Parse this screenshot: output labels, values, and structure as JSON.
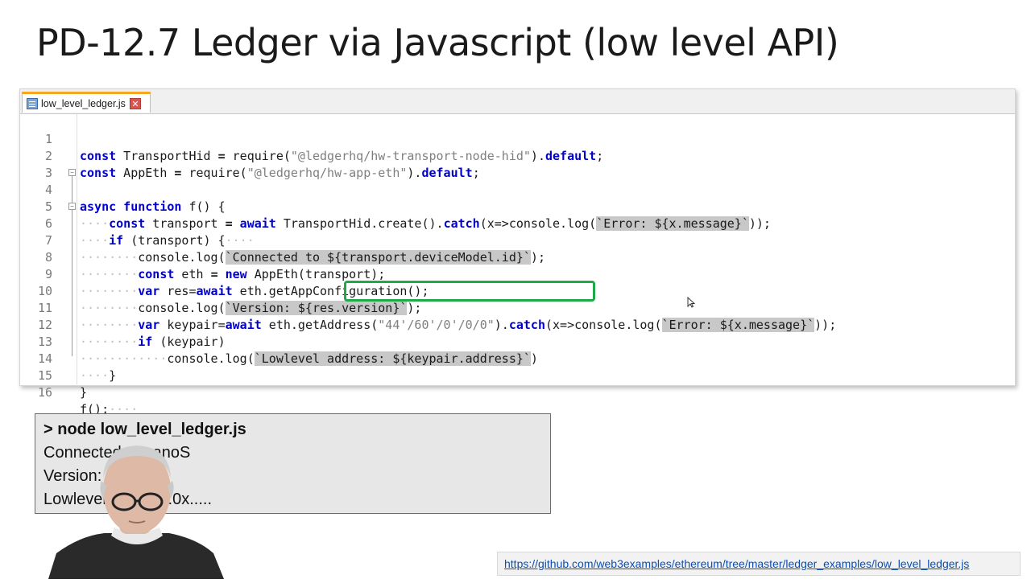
{
  "slide": {
    "title": "PD-12.7 Ledger via Javascript (low level API)"
  },
  "editor": {
    "tab_label": "low_level_ledger.js",
    "close_glyph": "✕",
    "fold_minus": "−",
    "line_numbers": [
      "1",
      "2",
      "3",
      "4",
      "5",
      "6",
      "7",
      "8",
      "9",
      "10",
      "11",
      "12",
      "13",
      "14",
      "15",
      "16"
    ],
    "highlight_color": "#1faa4a",
    "tab_accent_color": "#f5a623"
  },
  "code": {
    "l1": {
      "kw": "const",
      "a": " TransportHid ",
      "op": "=",
      "b": " require(",
      "str": "\"@ledgerhq/hw-transport-node-hid\"",
      "c": ").",
      "kw2": "default",
      "d": ";"
    },
    "l2": {
      "kw": "const",
      "a": " AppEth ",
      "op": "=",
      "b": " require(",
      "str": "\"@ledgerhq/hw-app-eth\"",
      "c": ").",
      "kw2": "default",
      "d": ";"
    },
    "l4": {
      "kw": "async function",
      "a": " f() {"
    },
    "l5": {
      "dots": "····",
      "kw": "const",
      "a": " transport ",
      "op": "=",
      "kw2": " await",
      "b": " TransportHid.create().",
      "kw3": "catch",
      "c": "(x=>console.log(",
      "tpl": "`Error: ${x.message}`",
      "d": "));"
    },
    "l6": {
      "dots": "····",
      "kw": "if",
      "a": " (transport) {",
      "dots2": "····"
    },
    "l7": {
      "dots": "········",
      "a": "console.log(",
      "tpl": "`Connected to ${transport.deviceModel.id}`",
      "b": ");"
    },
    "l8": {
      "dots": "········",
      "kw": "const",
      "a": " eth ",
      "op": "=",
      "kw2": " new",
      "b": " AppEth(transport);"
    },
    "l9": {
      "dots": "········",
      "kw": "var",
      "a": " res=",
      "kw2": "await",
      "b": " eth.getAppConfiguration();"
    },
    "l10": {
      "dots": "········",
      "a": "console.log(",
      "tpl": "`Version: ${res.version}`",
      "b": ");"
    },
    "l11": {
      "dots": "········",
      "kw": "var",
      "a": " keypair=",
      "kw2": "await",
      "b": " eth.getAddress(",
      "str": "\"44'/60'/0'/0/0\"",
      "c": ").",
      "kw3": "catch",
      "d": "(x=>console.log(",
      "tpl": "`Error: ${x.message}`",
      "e": "));"
    },
    "l12": {
      "dots": "········",
      "kw": "if",
      "a": " (keypair)"
    },
    "l13": {
      "dots": "············",
      "a": "console.log(",
      "tpl": "`Lowlevel address: ${keypair.address}`",
      "b": ")"
    },
    "l14": {
      "dots": "····",
      "a": "}"
    },
    "l15": {
      "a": "}"
    },
    "l16": {
      "a": "f();",
      "dots": "····"
    }
  },
  "terminal": {
    "command": "> node low_level_ledger.js",
    "line1": "Connected to nanoS",
    "line2": "Version: ",
    "line3": "Lowlevel address:0x....."
  },
  "footer": {
    "url": "https://github.com/web3examples/ethereum/tree/master/ledger_examples/low_level_ledger.js"
  }
}
